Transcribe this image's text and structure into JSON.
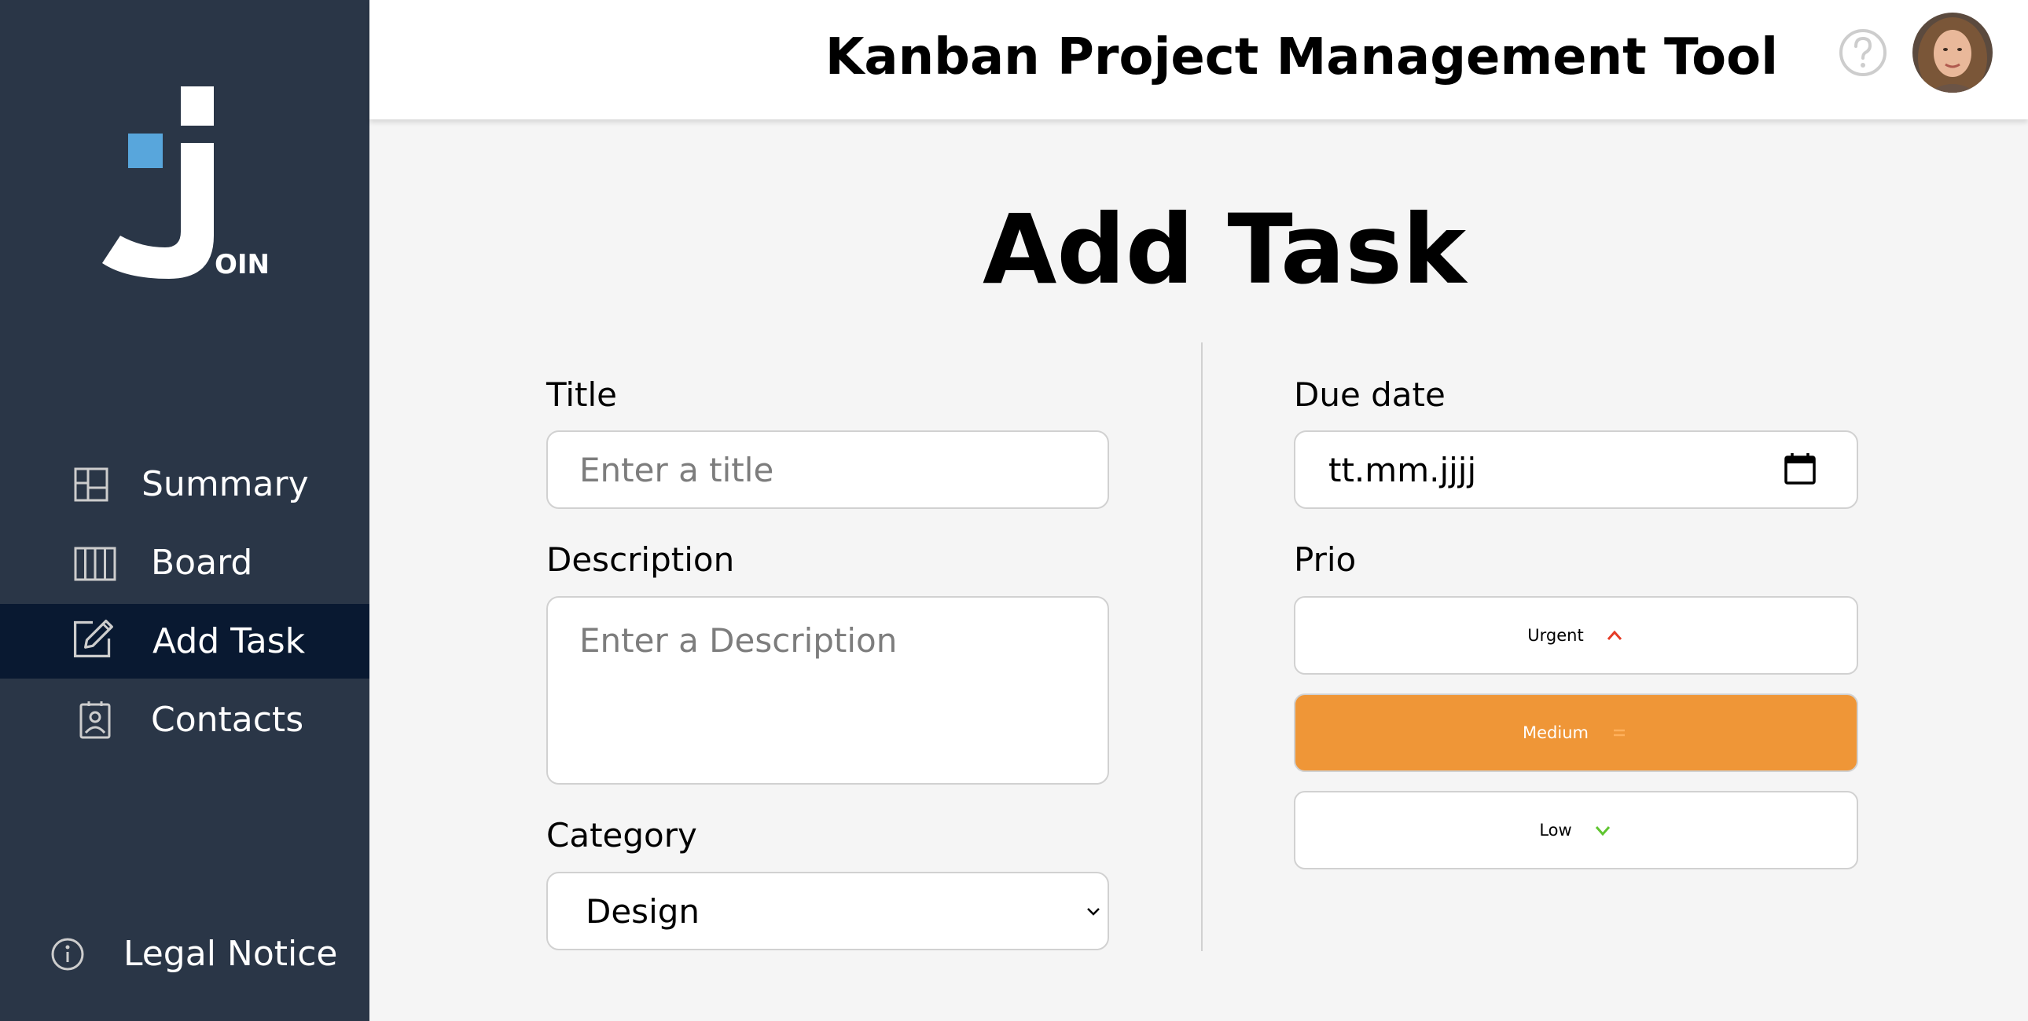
{
  "header": {
    "title": "Kanban Project Management Tool"
  },
  "sidebar": {
    "logo_text": "OIN",
    "items": [
      {
        "label": "Summary",
        "icon": "summary-icon"
      },
      {
        "label": "Board",
        "icon": "board-icon"
      },
      {
        "label": "Add Task",
        "icon": "add-task-icon",
        "active": true
      },
      {
        "label": "Contacts",
        "icon": "contacts-icon"
      }
    ],
    "legal_label": "Legal Notice"
  },
  "main": {
    "page_title": "Add Task",
    "title_field": {
      "label": "Title",
      "placeholder": "Enter a title"
    },
    "description_field": {
      "label": "Description",
      "placeholder": "Enter a Description"
    },
    "category_field": {
      "label": "Category",
      "value": "Design"
    },
    "due_date_field": {
      "label": "Due date",
      "value": "tt.mm.jjjj"
    },
    "prio": {
      "label": "Prio",
      "options": [
        {
          "label": "Urgent",
          "icon": "arrow-up-icon"
        },
        {
          "label": "Medium",
          "icon": "equals-icon",
          "selected": true
        },
        {
          "label": "Low",
          "icon": "arrow-down-icon"
        }
      ]
    }
  },
  "colors": {
    "sidebar_bg": "#2a3647",
    "sidebar_active": "#091931",
    "accent_blue": "#29abe2",
    "medium_orange": "#ef9637",
    "urgent_red": "#e53b26",
    "low_green": "#5fc530"
  }
}
